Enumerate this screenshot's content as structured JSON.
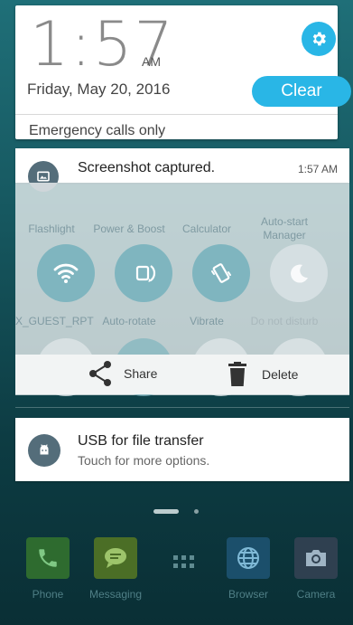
{
  "header": {
    "time": "1:57",
    "ampm": "AM",
    "date": "Friday, May 20, 2016",
    "clear_label": "Clear",
    "emergency_text": "Emergency calls only"
  },
  "screenshot_notification": {
    "title": "Screenshot captured.",
    "time": "1:57 AM"
  },
  "quick_settings": {
    "row1_labels": [
      "Flashlight",
      "Power & Boost",
      "Calculator",
      "Auto-start Manager"
    ],
    "row2": [
      {
        "label": "X_GUEST_RPT",
        "icon": "wifi-icon"
      },
      {
        "label": "Auto-rotate",
        "icon": "auto-rotate-icon"
      },
      {
        "label": "Vibrate",
        "icon": "vibrate-icon"
      },
      {
        "label": "Do not disturb",
        "icon": "moon-icon"
      }
    ]
  },
  "actions": {
    "share_label": "Share",
    "delete_label": "Delete"
  },
  "usb_notification": {
    "title": "USB for file transfer",
    "subtitle": "Touch for more options."
  },
  "dock": {
    "items": [
      {
        "label": "Phone",
        "color": "#2e7d32"
      },
      {
        "label": "Messaging",
        "color": "#558b2f"
      },
      {
        "label": "",
        "color": "transparent"
      },
      {
        "label": "Browser",
        "color": "#1e88a8"
      },
      {
        "label": "Camera",
        "color": "#37474f"
      }
    ]
  },
  "colors": {
    "accent": "#29b6e6",
    "qs_active": "#7fb5bf",
    "notif_icon_bg": "#546d7a"
  }
}
